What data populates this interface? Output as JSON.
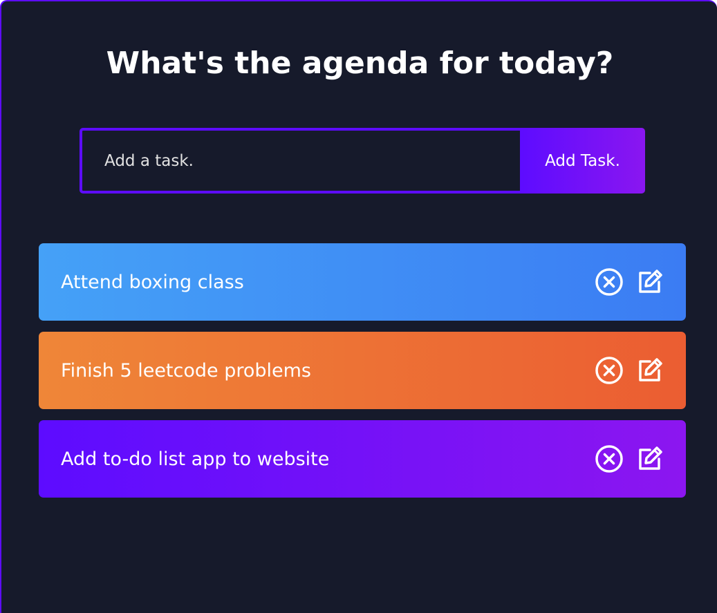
{
  "header": {
    "title": "What's the agenda for today?"
  },
  "form": {
    "placeholder": "Add a task.",
    "value": "",
    "add_button_label": "Add Task."
  },
  "colors": {
    "background": "#161a2b",
    "accent": "#5d0cff"
  },
  "todos": [
    {
      "text": "Attend boxing class",
      "gradient_start": "#45a1f7",
      "gradient_end": "#3b7cf3",
      "icons": [
        "close-circle-icon",
        "edit-icon"
      ]
    },
    {
      "text": "Finish 5 leetcode problems",
      "gradient_start": "#ef8638",
      "gradient_end": "#eb5d32",
      "icons": [
        "close-circle-icon",
        "edit-icon"
      ]
    },
    {
      "text": "Add to-do list app to website",
      "gradient_start": "#5d0cff",
      "gradient_end": "#8c16f0",
      "icons": [
        "close-circle-icon",
        "edit-icon"
      ]
    }
  ]
}
